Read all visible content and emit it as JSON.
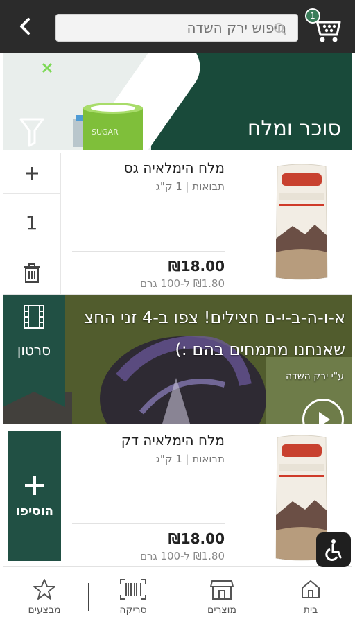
{
  "header": {
    "search_placeholder": "חיפוש ירק השדה",
    "cart_count": "1"
  },
  "category": {
    "title": "סוכר ומלח",
    "jar_text": "SUGAR"
  },
  "products": [
    {
      "name": "מלח הימלאיה גס",
      "brand": "תבואות",
      "size": "1 ק\"ג",
      "price": "₪18.00",
      "unit_price": "₪1.80 ל-100 גרם",
      "quantity": "1"
    },
    {
      "name": "מלח הימלאיה דק",
      "brand": "תבואות",
      "size": "1 ק\"ג",
      "price": "₪18.00",
      "unit_price": "₪1.80 ל-100 גרם",
      "add_label": "הוסיפו"
    }
  ],
  "video": {
    "line1": "א-ו-ה-ב-י-ם חצילים! צפו ב-4 זני החצ",
    "line2": "שאנחנו מתמחים בהם :)",
    "credit": "ע\"י ירק השדה",
    "tag_label": "סרטון"
  },
  "bottom_nav": [
    {
      "label": "בית",
      "icon": "home-icon"
    },
    {
      "label": "מוצרים",
      "icon": "store-icon"
    },
    {
      "label": "סריקה",
      "icon": "barcode-icon"
    },
    {
      "label": "מבצעים",
      "icon": "star-icon"
    }
  ],
  "colors": {
    "header_bg": "#2b2b2b",
    "brand_green": "#215044",
    "banner_dark": "#194a3a"
  }
}
